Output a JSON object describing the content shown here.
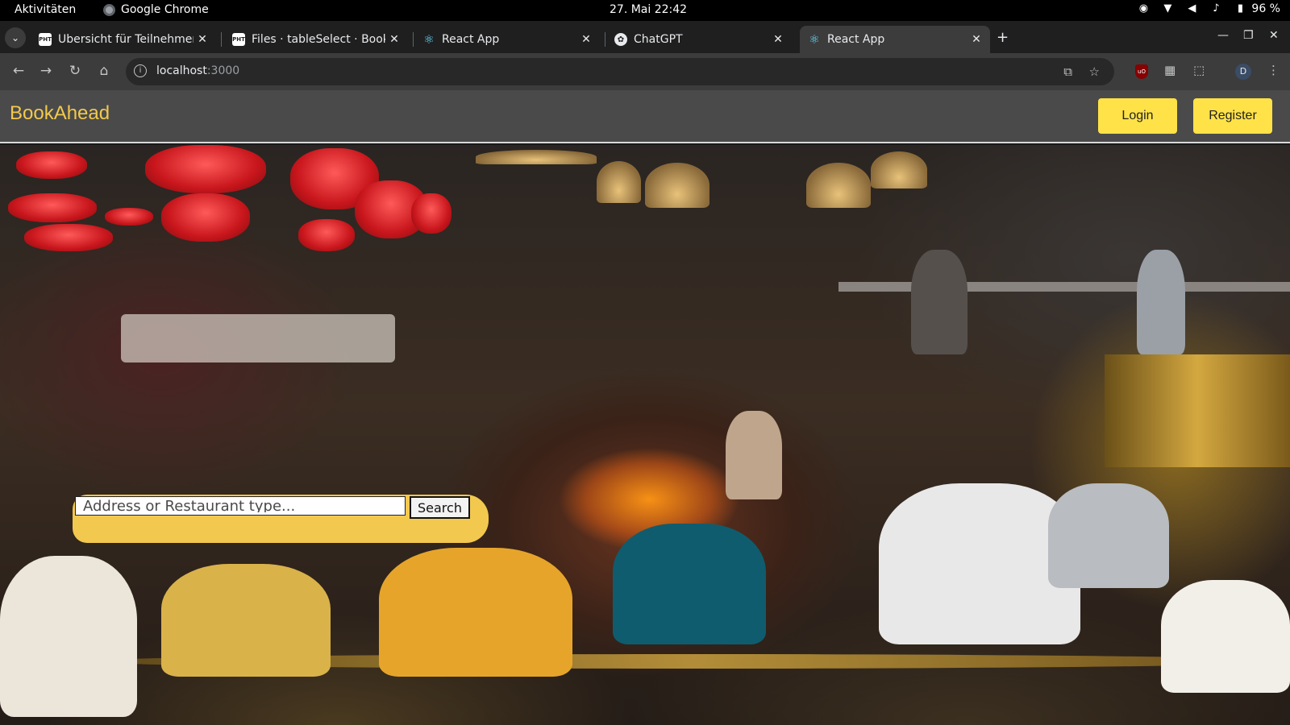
{
  "system_bar": {
    "activities": "Aktivitäten",
    "app_name": "Google Chrome",
    "clock": "27. Mai  22:42",
    "battery": "96 %"
  },
  "tabs": [
    {
      "title": "Übersicht für Teilnehmer",
      "favicon": "ht-logo"
    },
    {
      "title": "Files · tableSelect · Book",
      "favicon": "ht-logo"
    },
    {
      "title": "React App",
      "favicon": "react-icon"
    },
    {
      "title": "ChatGPT",
      "favicon": "chatgpt-icon"
    },
    {
      "title": "React App",
      "favicon": "react-icon",
      "active": true
    }
  ],
  "address_bar": {
    "host": "localhost",
    "port": ":3000"
  },
  "profile_initial": "D",
  "app": {
    "brand": "BookAhead",
    "login_label": "Login",
    "register_label": "Register",
    "search_placeholder": "Address or Restaurant type...",
    "search_label": "Search"
  },
  "colors": {
    "brand": "#f2c94c",
    "button": "#ffe247",
    "appbar": "#4a4a4a",
    "search_pill": "#f3c84e"
  }
}
